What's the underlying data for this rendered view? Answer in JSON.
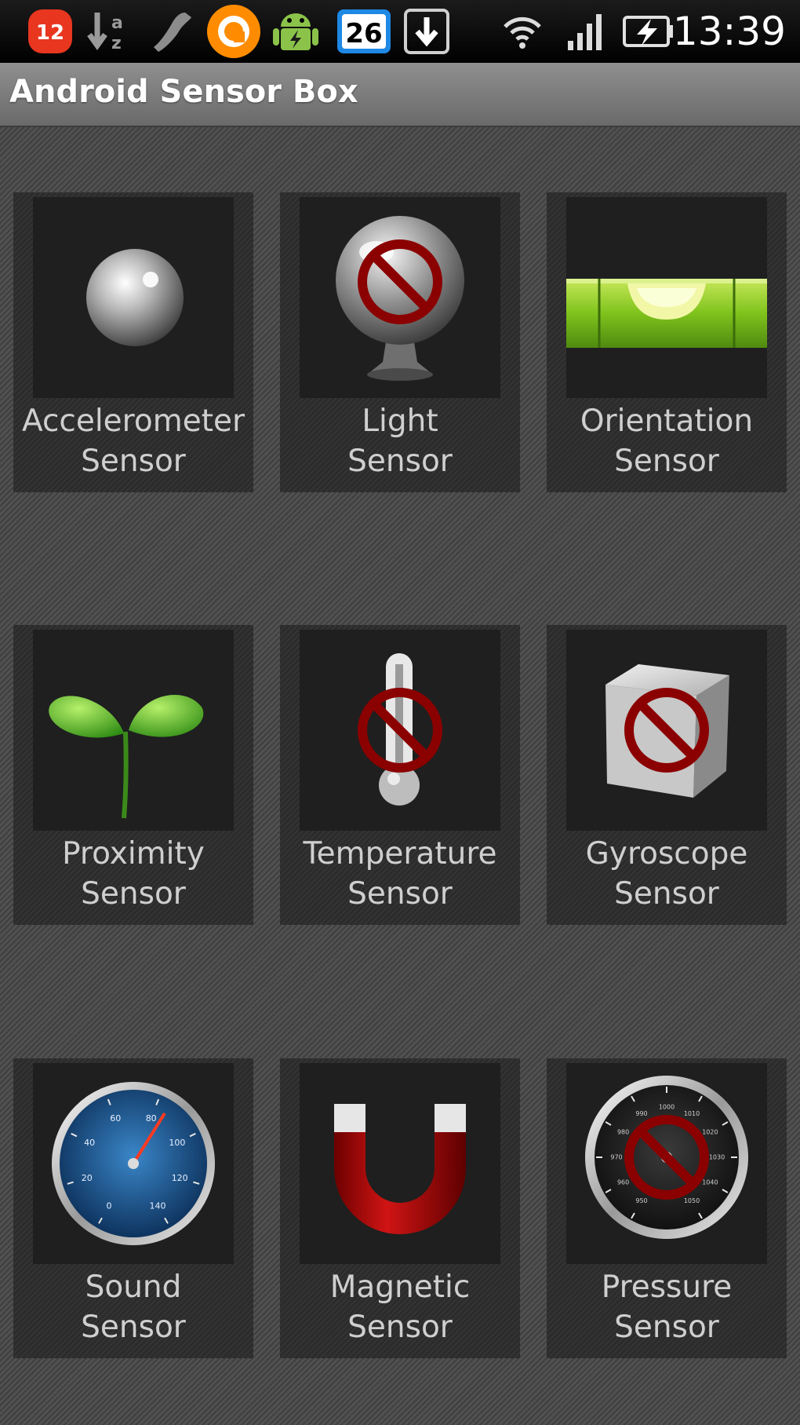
{
  "status_bar": {
    "notification_count": "12",
    "calendar_day": "26",
    "time": "13:39",
    "icons": [
      "badge-12-icon",
      "sort-az-icon",
      "phone-icon",
      "orange-ring-app-icon",
      "android-charging-icon",
      "calendar-icon",
      "download-icon",
      "wifi-icon",
      "signal-icon",
      "battery-charging-icon"
    ]
  },
  "app": {
    "title": "Android Sensor Box"
  },
  "sensors": [
    {
      "line1": "Accelerometer",
      "line2": "Sensor",
      "icon": "steel-ball-icon",
      "available": true
    },
    {
      "line1": "Light",
      "line2": "Sensor",
      "icon": "crystal-ball-icon",
      "available": false
    },
    {
      "line1": "Orientation",
      "line2": "Sensor",
      "icon": "spirit-level-icon",
      "available": true
    },
    {
      "line1": "Proximity",
      "line2": "Sensor",
      "icon": "sprout-icon",
      "available": true
    },
    {
      "line1": "Temperature",
      "line2": "Sensor",
      "icon": "thermometer-icon",
      "available": false
    },
    {
      "line1": "Gyroscope",
      "line2": "Sensor",
      "icon": "cube-icon",
      "available": false
    },
    {
      "line1": "Sound",
      "line2": "Sensor",
      "icon": "speedometer-icon",
      "available": true
    },
    {
      "line1": "Magnetic",
      "line2": "Sensor",
      "icon": "magnet-icon",
      "available": true
    },
    {
      "line1": "Pressure",
      "line2": "Sensor",
      "icon": "barometer-icon",
      "available": false
    }
  ],
  "gauges": {
    "sound_ticks": [
      "0",
      "20",
      "40",
      "60",
      "80",
      "100",
      "120",
      "140"
    ],
    "pressure_ticks": [
      "950",
      "960",
      "970",
      "980",
      "990",
      "1000",
      "1010",
      "1020",
      "1030",
      "1040",
      "1050"
    ]
  },
  "colors": {
    "unavailable_sign": "#8b0000",
    "label_text": "#cfcfcf",
    "title_text": "#ffffff"
  }
}
